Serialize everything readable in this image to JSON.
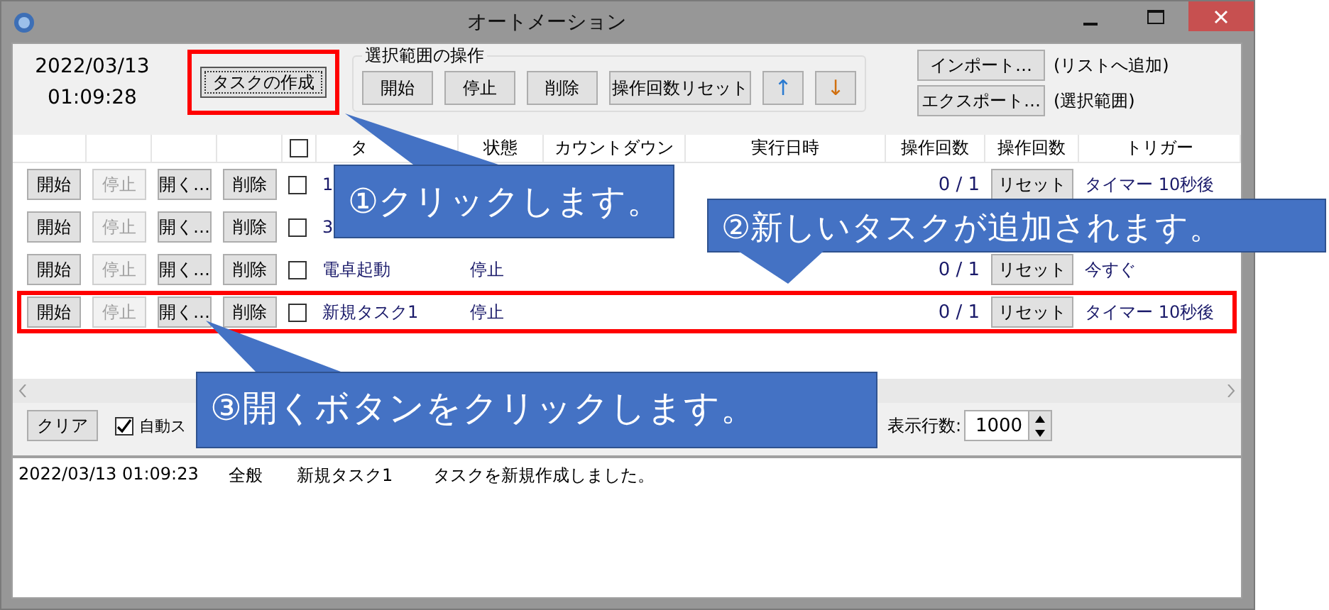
{
  "window": {
    "title": "オートメーション"
  },
  "clock": {
    "date": "2022/03/13",
    "time": "01:09:28"
  },
  "create_button": {
    "label": "タスクの作成",
    "highlighted": true
  },
  "selection_group": {
    "title": "選択範囲の操作",
    "buttons": [
      {
        "label": "開始",
        "kind": "text"
      },
      {
        "label": "停止",
        "kind": "text"
      },
      {
        "label": "削除",
        "kind": "text"
      },
      {
        "label": "操作回数リセット",
        "kind": "text"
      },
      {
        "label": "↑",
        "kind": "arrow"
      },
      {
        "label": "↓",
        "kind": "arrow"
      }
    ]
  },
  "file_actions": [
    {
      "button": "インポート…",
      "note": "(リストへ追加)"
    },
    {
      "button": "エクスポート…",
      "note": "(選択範囲)"
    }
  ],
  "table": {
    "header_checked": false,
    "columns": [
      "タ",
      "状態",
      "カウントダウン",
      "実行日時",
      "操作回数",
      "操作回数",
      "トリガー"
    ],
    "rows": [
      {
        "buttons": [
          {
            "label": "開始",
            "disabled": false
          },
          {
            "label": "停止",
            "disabled": true
          },
          {
            "label": "開く…",
            "disabled": false
          },
          {
            "label": "削除",
            "disabled": false
          }
        ],
        "checked": false,
        "name": "1",
        "count": "0 / 1",
        "reset": "リセット",
        "trigger": "タイマー 10秒後",
        "highlighted": false
      },
      {
        "buttons": [
          {
            "label": "開始",
            "disabled": false
          },
          {
            "label": "停止",
            "disabled": true
          },
          {
            "label": "開く…",
            "disabled": false
          },
          {
            "label": "削除",
            "disabled": false
          }
        ],
        "checked": false,
        "name": "3",
        "highlighted": false
      },
      {
        "buttons": [
          {
            "label": "開始",
            "disabled": false
          },
          {
            "label": "停止",
            "disabled": true
          },
          {
            "label": "開く…",
            "disabled": false
          },
          {
            "label": "削除",
            "disabled": false
          }
        ],
        "checked": false,
        "name": "電卓起動",
        "status": "停止",
        "count": "0 / 1",
        "reset": "リセット",
        "trigger": "今すぐ",
        "highlighted": false
      },
      {
        "buttons": [
          {
            "label": "開始",
            "disabled": false
          },
          {
            "label": "停止",
            "disabled": true
          },
          {
            "label": "開く…",
            "disabled": false
          },
          {
            "label": "削除",
            "disabled": false
          }
        ],
        "checked": false,
        "name": "新規タスク1",
        "status": "停止",
        "count": "0 / 1",
        "reset": "リセット",
        "trigger": "タイマー 10秒後",
        "highlighted": true
      }
    ]
  },
  "log_controls": {
    "clear_button": "クリア",
    "auto_scroll": {
      "label": "自動ス",
      "checked": true
    },
    "rows_shown": {
      "label": "表示行数:",
      "value": "1000"
    }
  },
  "log": [
    {
      "time": "2022/03/13 01:09:23",
      "category": "全般",
      "task": "新規タスク1",
      "message": "タスクを新規作成しました。"
    }
  ],
  "callouts": [
    {
      "text": "①クリックします。"
    },
    {
      "text": "②新しいタスクが追加されます。"
    },
    {
      "text": "③開くボタンをクリックします。"
    }
  ]
}
